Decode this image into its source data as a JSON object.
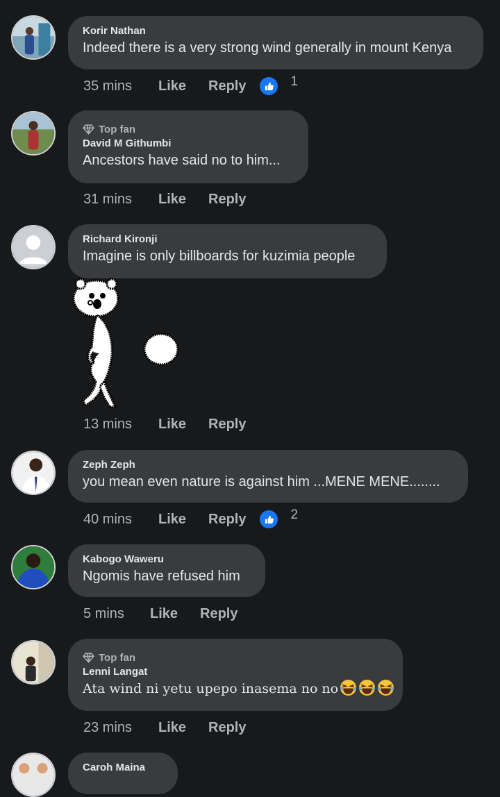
{
  "comments": [
    {
      "name": "Korir Nathan",
      "top_fan": "",
      "text": "Indeed there is a very strong wind generally in mount Kenya",
      "time": "35 mins",
      "like": "Like",
      "reply": "Reply",
      "reactions": "1"
    },
    {
      "name": "David M Githumbi",
      "top_fan": "Top fan",
      "text": "Ancestors have said no to him...",
      "time": "31 mins",
      "like": "Like",
      "reply": "Reply",
      "reactions": ""
    },
    {
      "name": "Richard Kironji",
      "top_fan": "",
      "text": "Imagine is only billboards for kuzimia people",
      "time": "13 mins",
      "like": "Like",
      "reply": "Reply",
      "reactions": "",
      "sticker": "bear-sticker"
    },
    {
      "name": "Zeph Zeph",
      "top_fan": "",
      "text": "you mean even nature is against him ...MENE MENE........",
      "time": "40 mins",
      "like": "Like",
      "reply": "Reply",
      "reactions": "2"
    },
    {
      "name": "Kabogo Waweru",
      "top_fan": "",
      "text": "Ngomis have refused him",
      "time": "5 mins",
      "like": "Like",
      "reply": "Reply",
      "reactions": ""
    },
    {
      "name": "Lenni Langat",
      "top_fan": "Top fan",
      "text": "Ata wind ni yetu upepo inasema no no",
      "emoji": "laughing-emoji",
      "time": "23 mins",
      "like": "Like",
      "reply": "Reply",
      "reactions": ""
    },
    {
      "name": "Caroh Maina",
      "top_fan": "",
      "text": "",
      "time": "",
      "like": "",
      "reply": "",
      "reactions": ""
    }
  ],
  "icons": {
    "top_fan": "diamond-icon",
    "reaction": "like-reaction-icon"
  },
  "colors": {
    "background": "#18191a",
    "bubble": "#3a3b3c",
    "text": "#e4e6eb",
    "muted": "#b0b3b8",
    "like_blue": "#1877f2"
  }
}
